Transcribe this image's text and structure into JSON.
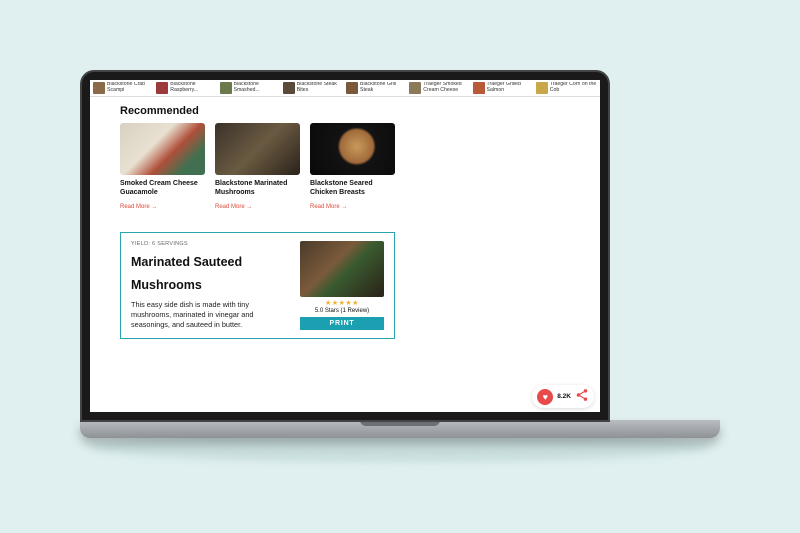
{
  "topnav": [
    {
      "label": "Blackstone Crab Scampi"
    },
    {
      "label": "Blackstone Raspberry..."
    },
    {
      "label": "Blackstone Smashed..."
    },
    {
      "label": "Blackstone Steak Bites"
    },
    {
      "label": "Blackstone Grill Steak"
    },
    {
      "label": "Traeger Smoked Cream Cheese"
    },
    {
      "label": "Traeger Grilled Salmon"
    },
    {
      "label": "Traeger Corn on the Cob"
    }
  ],
  "recommended": {
    "heading": "Recommended",
    "cards": [
      {
        "title": "Smoked Cream Cheese Guacamole",
        "more": "Read More →"
      },
      {
        "title": "Blackstone Marinated Mushrooms",
        "more": "Read More →"
      },
      {
        "title": "Blackstone Seared Chicken Breasts",
        "more": "Read More →"
      }
    ]
  },
  "recipe": {
    "yield": "YIELD: 6 SERVINGS",
    "title": "Marinated Sauteed Mushrooms",
    "description": "This easy side dish is made with tiny mushrooms, marinated in vinegar and seasonings, and sauteed in butter.",
    "stars": "★★★★★",
    "rating_text": "5.0 Stars (1 Review)",
    "print": "PRINT"
  },
  "float": {
    "heart": "♥",
    "count": "8.2K",
    "share": "‹"
  }
}
